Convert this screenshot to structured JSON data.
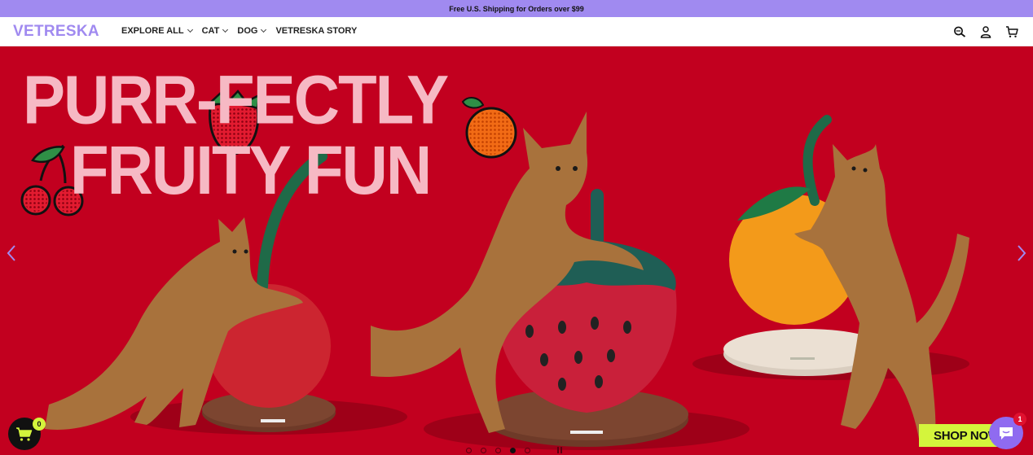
{
  "announcement": {
    "text": "Free U.S. Shipping for Orders over $99"
  },
  "header": {
    "logo": "VETRESKA",
    "nav": [
      {
        "label": "EXPLORE ALL",
        "dropdown": true
      },
      {
        "label": "CAT",
        "dropdown": true
      },
      {
        "label": "DOG",
        "dropdown": true
      },
      {
        "label": "VETRESKA STORY",
        "dropdown": false
      }
    ],
    "icons": [
      "search-icon",
      "account-icon",
      "cart-icon"
    ]
  },
  "hero": {
    "headline_line1": "PURR-FECTLY",
    "headline_line2": "FRUITY FUN",
    "background": "#c2001f",
    "headline_color": "#f6b9c4",
    "slides": {
      "count": 5,
      "active_index": 3
    },
    "cta": "SHOP NOW",
    "cta_color": "#d4f53c"
  },
  "floating": {
    "cart_count": "0",
    "chat_count": "1",
    "accent": "#a08af0"
  }
}
